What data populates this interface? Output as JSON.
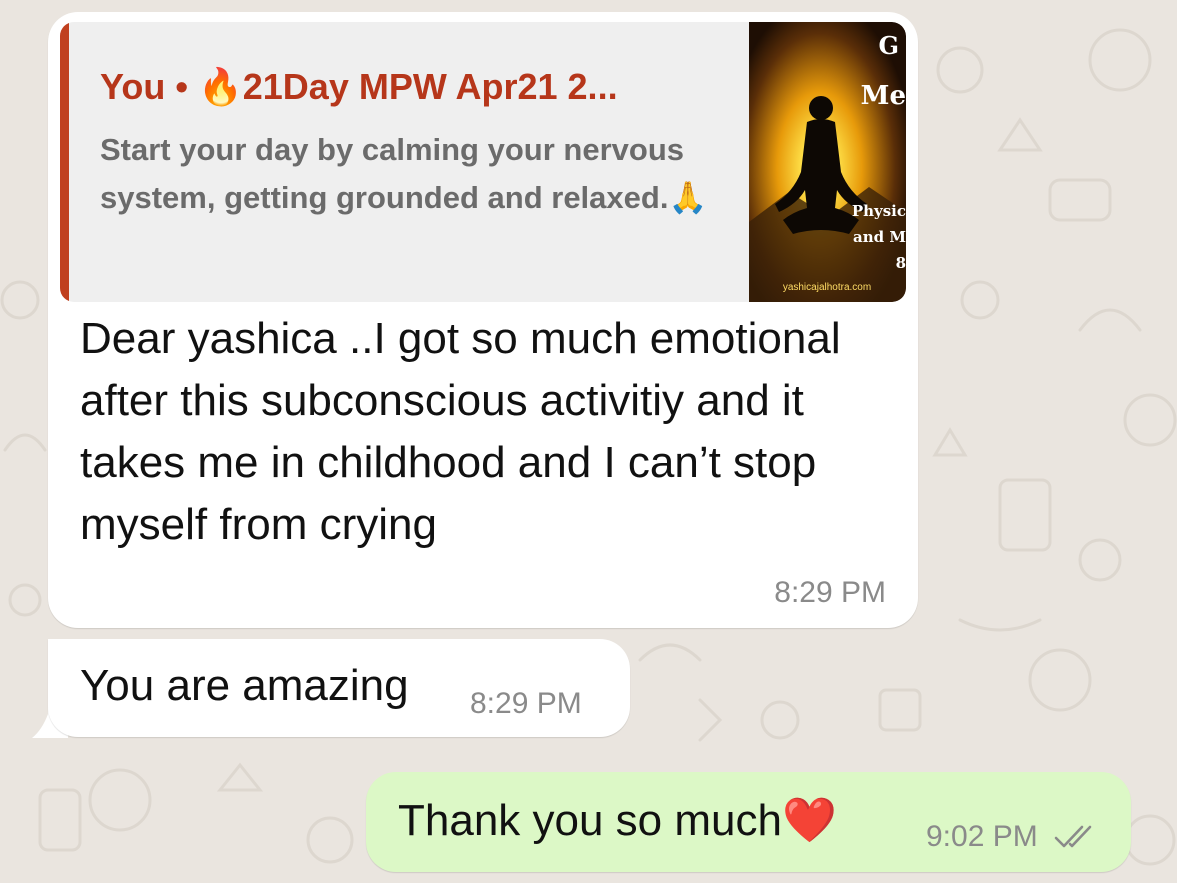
{
  "messages": [
    {
      "direction": "incoming",
      "quote": {
        "author": "You",
        "separator": "•",
        "emoji": "🔥",
        "title": "21Day MPW Apr21 2...",
        "text": "Start your day by calming your nervous system, getting grounded and relaxed.",
        "text_emoji": "🙏",
        "thumbnail": {
          "caption_lines": [
            "G",
            "Me",
            "Physic",
            "and M",
            "8"
          ],
          "watermark": "yashicajalhotra.com"
        }
      },
      "text": "Dear yashica ..I got so much emotional after this subconscious activitiy and it takes me in childhood and I can’t stop myself from crying",
      "time": "8:29 PM"
    },
    {
      "direction": "incoming",
      "text": "You are amazing",
      "time": "8:29 PM"
    },
    {
      "direction": "outgoing",
      "text": "Thank you so much",
      "emoji": "❤️",
      "time": "9:02 PM",
      "status": "read"
    }
  ],
  "colors": {
    "background": "#eae5df",
    "incoming_bubble": "#ffffff",
    "outgoing_bubble": "#dcf8c6",
    "quote_accent": "#c0401f",
    "quote_author": "#b6361a",
    "timestamp": "#8a8a8a"
  },
  "icons": {
    "read_receipt": "double-check-icon"
  }
}
